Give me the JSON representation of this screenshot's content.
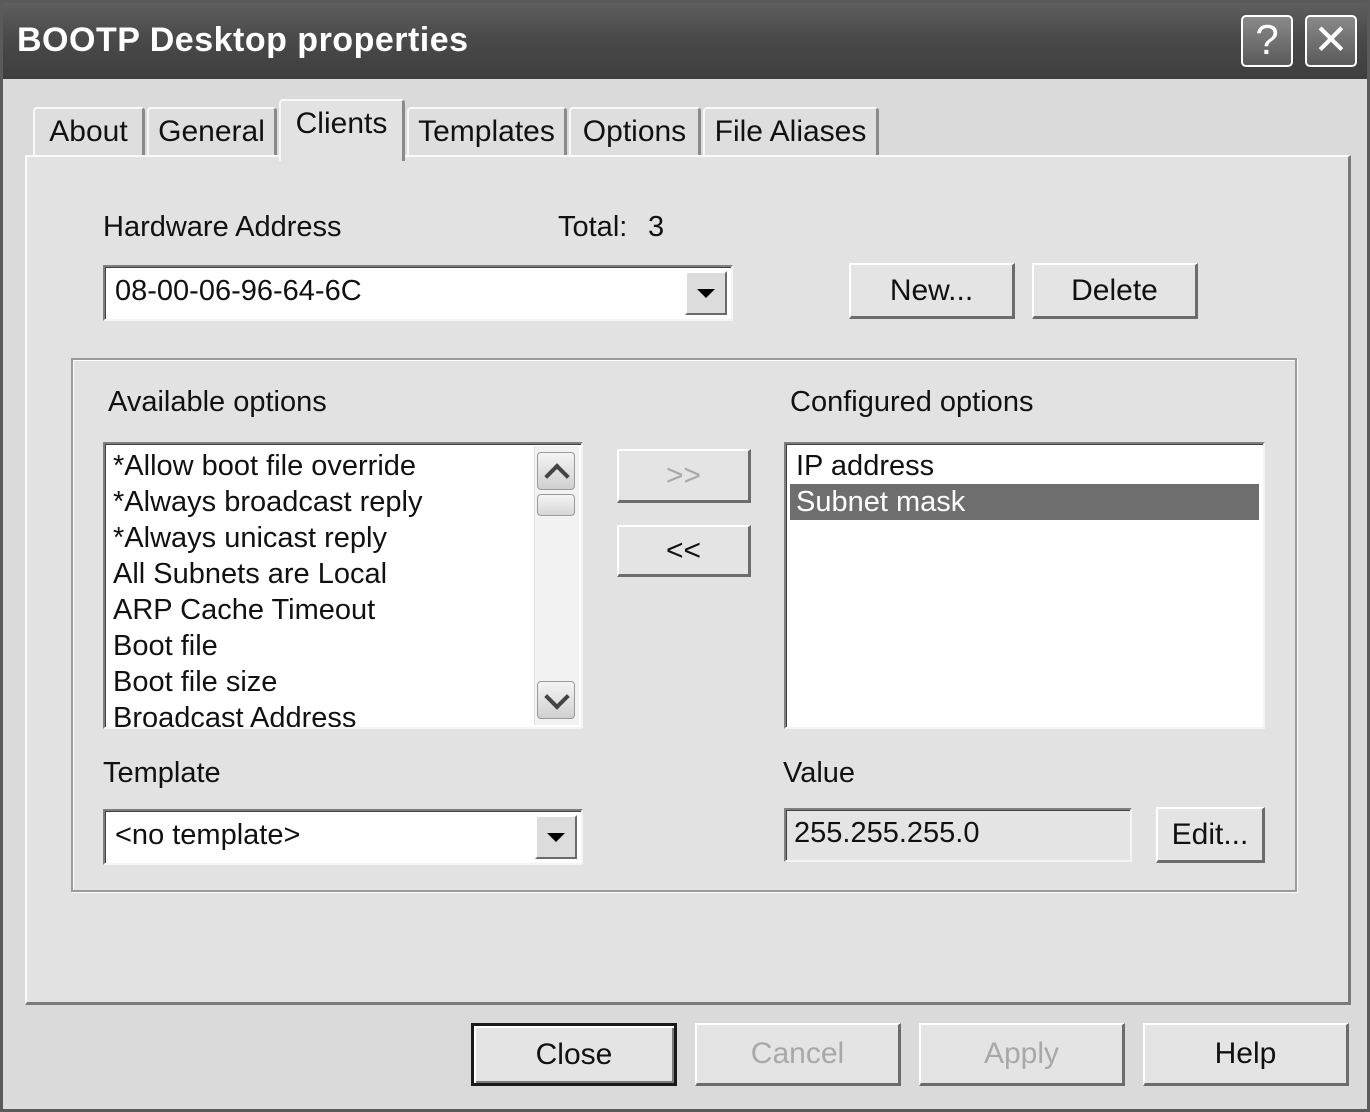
{
  "window": {
    "title": "BOOTP Desktop properties",
    "help_glyph": "?",
    "close_glyph": "✕"
  },
  "tabs": [
    {
      "label": "About"
    },
    {
      "label": "General"
    },
    {
      "label": "Clients",
      "active": true
    },
    {
      "label": "Templates"
    },
    {
      "label": "Options"
    },
    {
      "label": "File Aliases"
    }
  ],
  "hardware": {
    "label": "Hardware Address",
    "total_label": "Total:",
    "total_value": "3",
    "selected": "08-00-06-96-64-6C",
    "new_label": "New...",
    "delete_label": "Delete"
  },
  "available": {
    "label": "Available options",
    "items": [
      "*Allow boot file override",
      "*Always broadcast reply",
      "*Always unicast reply",
      "All Subnets are Local",
      "ARP Cache Timeout",
      "Boot file",
      "Boot file size",
      "Broadcast Address"
    ]
  },
  "transfer": {
    "add_label": ">>",
    "remove_label": "<<"
  },
  "configured": {
    "label": "Configured options",
    "items": [
      "IP address",
      "Subnet mask"
    ],
    "selected_index": 1
  },
  "template": {
    "label": "Template",
    "selected": "<no template>"
  },
  "value": {
    "label": "Value",
    "current": "255.255.255.0",
    "edit_label": "Edit..."
  },
  "footer": {
    "close_label": "Close",
    "cancel_label": "Cancel",
    "apply_label": "Apply",
    "help_label": "Help"
  }
}
